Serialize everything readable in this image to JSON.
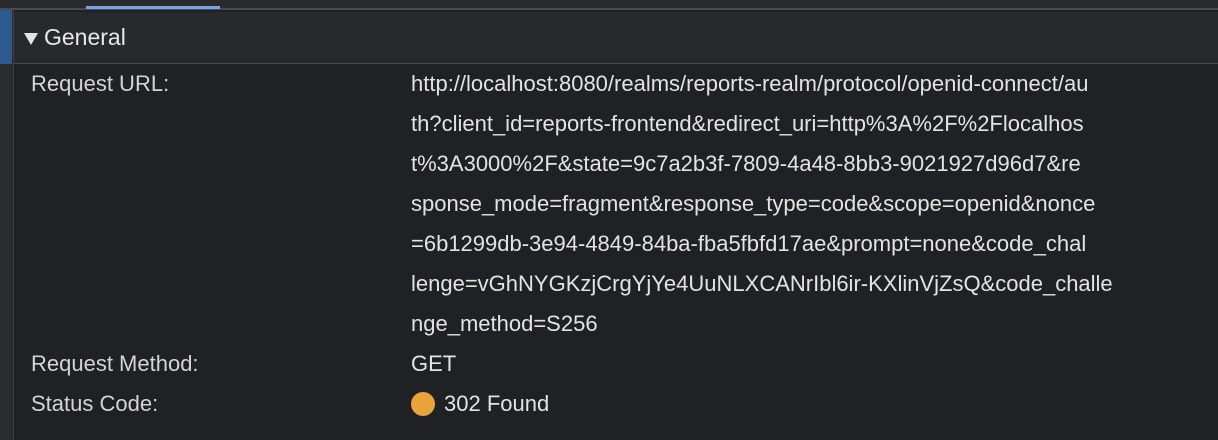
{
  "section": {
    "title": "General"
  },
  "rows": {
    "request_url": {
      "key": "Request URL:",
      "value_lines": [
        "http://localhost:8080/realms/reports-realm/protocol/openid-connect/au",
        "th?client_id=reports-frontend&redirect_uri=http%3A%2F%2Flocalhos",
        "t%3A3000%2F&state=9c7a2b3f-7809-4a48-8bb3-9021927d96d7&re",
        "sponse_mode=fragment&response_type=code&scope=openid&nonce",
        "=6b1299db-3e94-4849-84ba-fba5fbfd17ae&prompt=none&code_chal",
        "lenge=vGhNYGKzjCrgYjYe4UuNLXCANrIbl6ir-KXlinVjZsQ&code_challe",
        "nge_method=S256"
      ]
    },
    "request_method": {
      "key": "Request Method:",
      "value": "GET"
    },
    "status_code": {
      "key": "Status Code:",
      "value": "302 Found",
      "dot_color": "#e8a33a",
      "icon": "status-dot-icon"
    }
  },
  "colors": {
    "background": "#202124",
    "header_background": "#28292c",
    "tab_indicator": "#7aa3ea",
    "selection": "#2d5a8e"
  }
}
